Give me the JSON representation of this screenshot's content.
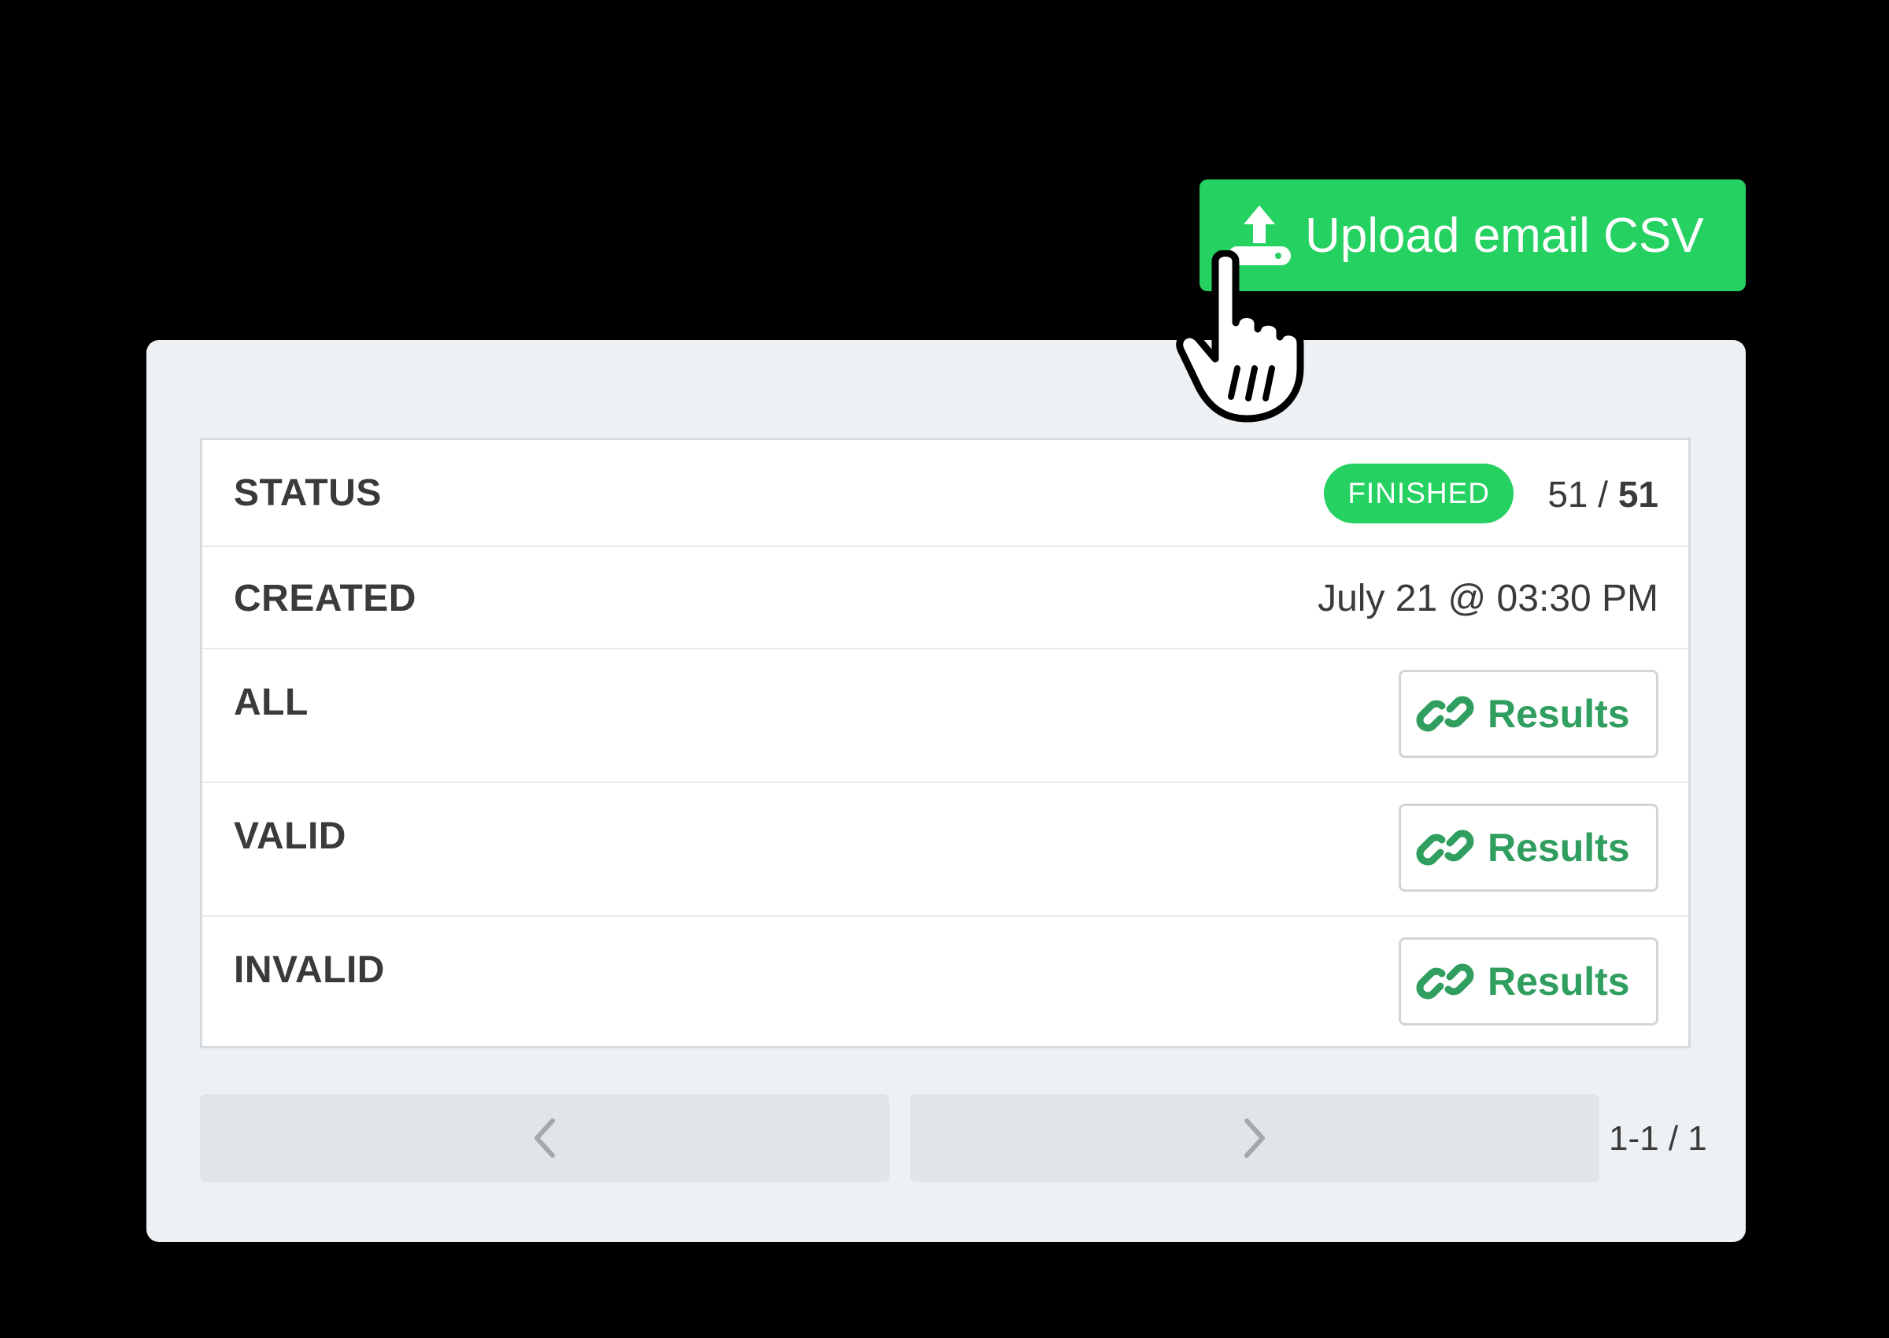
{
  "upload_button": {
    "label": "Upload email CSV",
    "icon": "upload-icon",
    "color": "#25d161"
  },
  "status_panel": {
    "status": {
      "label": "STATUS",
      "badge": "FINISHED",
      "processed": "51",
      "separator": " / ",
      "total": "51"
    },
    "created": {
      "label": "CREATED",
      "value": "July 21 @ 03:30 PM"
    },
    "rows": [
      {
        "label": "ALL",
        "button_label": "Results"
      },
      {
        "label": "VALID",
        "button_label": "Results"
      },
      {
        "label": "INVALID",
        "button_label": "Results"
      }
    ]
  },
  "pagination": {
    "prev_icon": "chevron-left-icon",
    "next_icon": "chevron-right-icon",
    "range": "1-1 / 1"
  },
  "colors": {
    "accent": "#25d161",
    "link_text": "#2f9e5e",
    "panel_bg": "#edf1f4",
    "page_bg": "#000000"
  },
  "cursor": {
    "icon": "hand-pointer-icon"
  }
}
